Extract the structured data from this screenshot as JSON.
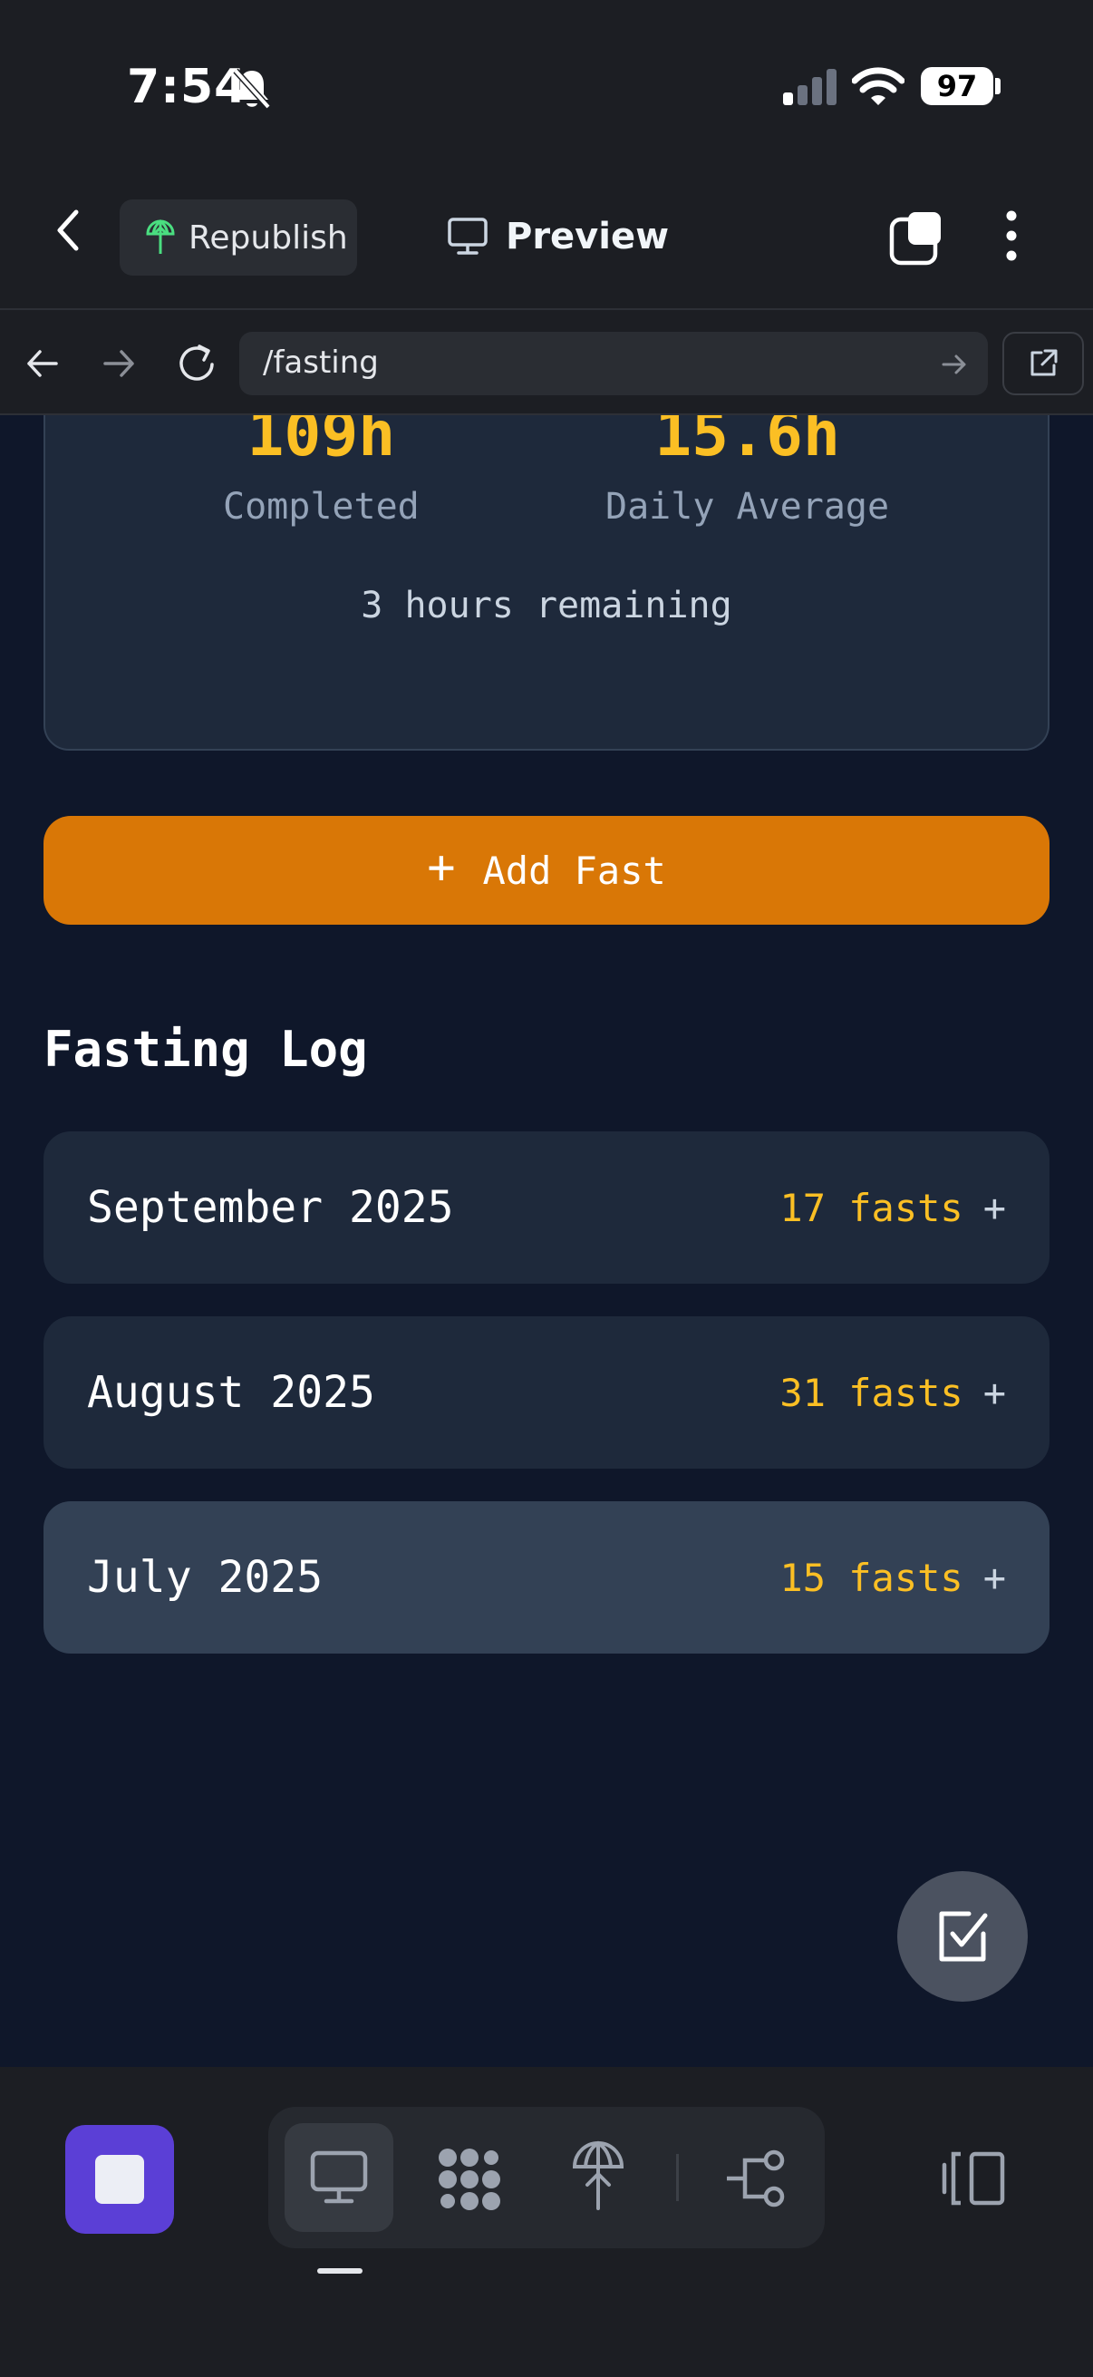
{
  "status": {
    "time": "7:54",
    "battery": "97"
  },
  "header": {
    "republish_label": "Republish",
    "preview_label": "Preview"
  },
  "browser": {
    "url": "/fasting"
  },
  "stats": {
    "completed_value": "109h",
    "completed_label": "Completed",
    "average_value": "15.6h",
    "average_label": "Daily Average",
    "remaining": "3 hours remaining"
  },
  "add_fast": {
    "plus": "+",
    "label": "Add Fast"
  },
  "log": {
    "title": "Fasting Log",
    "months": [
      {
        "name": "September 2025",
        "count": "17 fasts",
        "expand": "+"
      },
      {
        "name": "August 2025",
        "count": "31 fasts",
        "expand": "+"
      },
      {
        "name": "July 2025",
        "count": "15 fasts",
        "expand": "+"
      }
    ]
  },
  "colors": {
    "accent": "#d97706",
    "highlight": "#fbbf24",
    "card": "#1e293b",
    "page": "#0f172a",
    "stop": "#5b3fd6"
  },
  "icons": [
    "bell-slash-icon",
    "signal-icon",
    "wifi-icon",
    "battery-icon",
    "chevron-left-icon",
    "republish-icon",
    "monitor-icon",
    "tabs-icon",
    "more-vertical-icon",
    "arrow-left-icon",
    "arrow-right-icon",
    "reload-icon",
    "external-link-icon",
    "checkbox-icon",
    "stop-icon",
    "desktop-icon",
    "dots-grid-icon",
    "deploy-icon",
    "workflow-icon",
    "panel-icon"
  ]
}
